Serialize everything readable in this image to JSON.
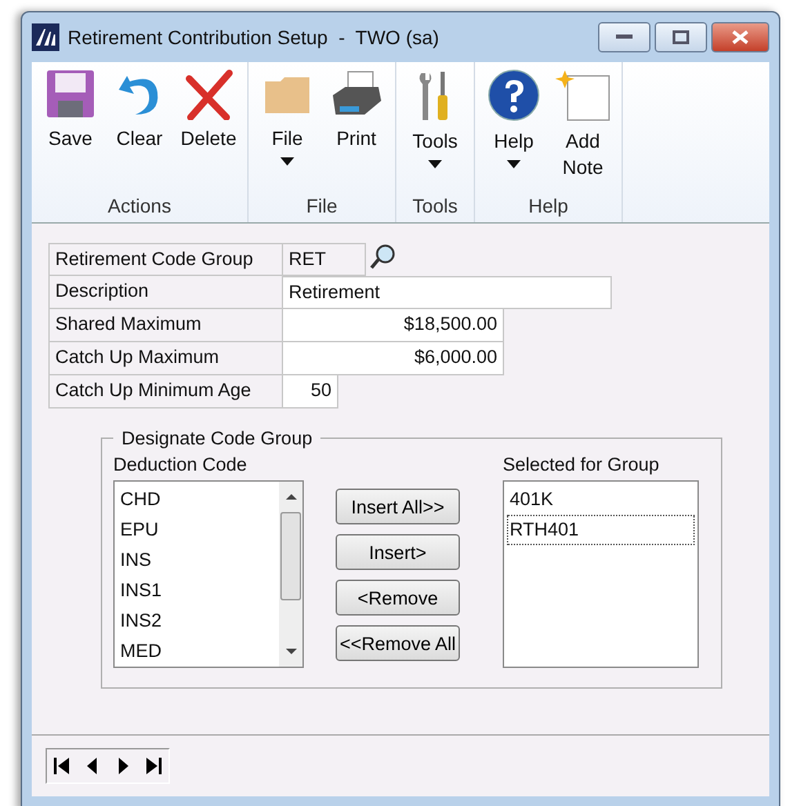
{
  "window": {
    "title": "Retirement Contribution Setup  -  TWO (sa)"
  },
  "ribbon": {
    "groups": [
      {
        "label": "Actions",
        "buttons": [
          {
            "label": "Save",
            "kind": "button"
          },
          {
            "label": "Clear",
            "kind": "button"
          },
          {
            "label": "Delete",
            "kind": "button"
          }
        ]
      },
      {
        "label": "File",
        "buttons": [
          {
            "label": "File",
            "kind": "dropdown"
          },
          {
            "label": "Print",
            "kind": "button"
          }
        ]
      },
      {
        "label": "Tools",
        "buttons": [
          {
            "label": "Tools",
            "kind": "dropdown"
          }
        ]
      },
      {
        "label": "Help",
        "buttons": [
          {
            "label": "Help",
            "kind": "dropdown"
          },
          {
            "label": "Add\nNote",
            "kind": "button"
          }
        ]
      }
    ]
  },
  "form": {
    "fields": [
      {
        "label": "Retirement Code Group",
        "value": "RET",
        "kind": "lookup"
      },
      {
        "label": "Description",
        "value": "Retirement",
        "kind": "text"
      },
      {
        "label": "Shared Maximum",
        "value": "$18,500.00",
        "kind": "amount"
      },
      {
        "label": "Catch Up Maximum",
        "value": "$6,000.00",
        "kind": "amount"
      },
      {
        "label": "Catch Up Minimum Age",
        "value": "50",
        "kind": "number"
      }
    ]
  },
  "designate_code_group": {
    "title": "Designate Code Group",
    "deduction_code": {
      "label": "Deduction Code",
      "items": [
        "CHD",
        "EPU",
        "INS",
        "INS1",
        "INS2",
        "MED"
      ]
    },
    "buttons": [
      "Insert All>>",
      "Insert>",
      "<Remove",
      "<<Remove All"
    ],
    "selected_for_group": {
      "label": "Selected for Group",
      "items": [
        {
          "text": "401K",
          "focused": false
        },
        {
          "text": "RTH401",
          "focused": true
        }
      ]
    }
  }
}
